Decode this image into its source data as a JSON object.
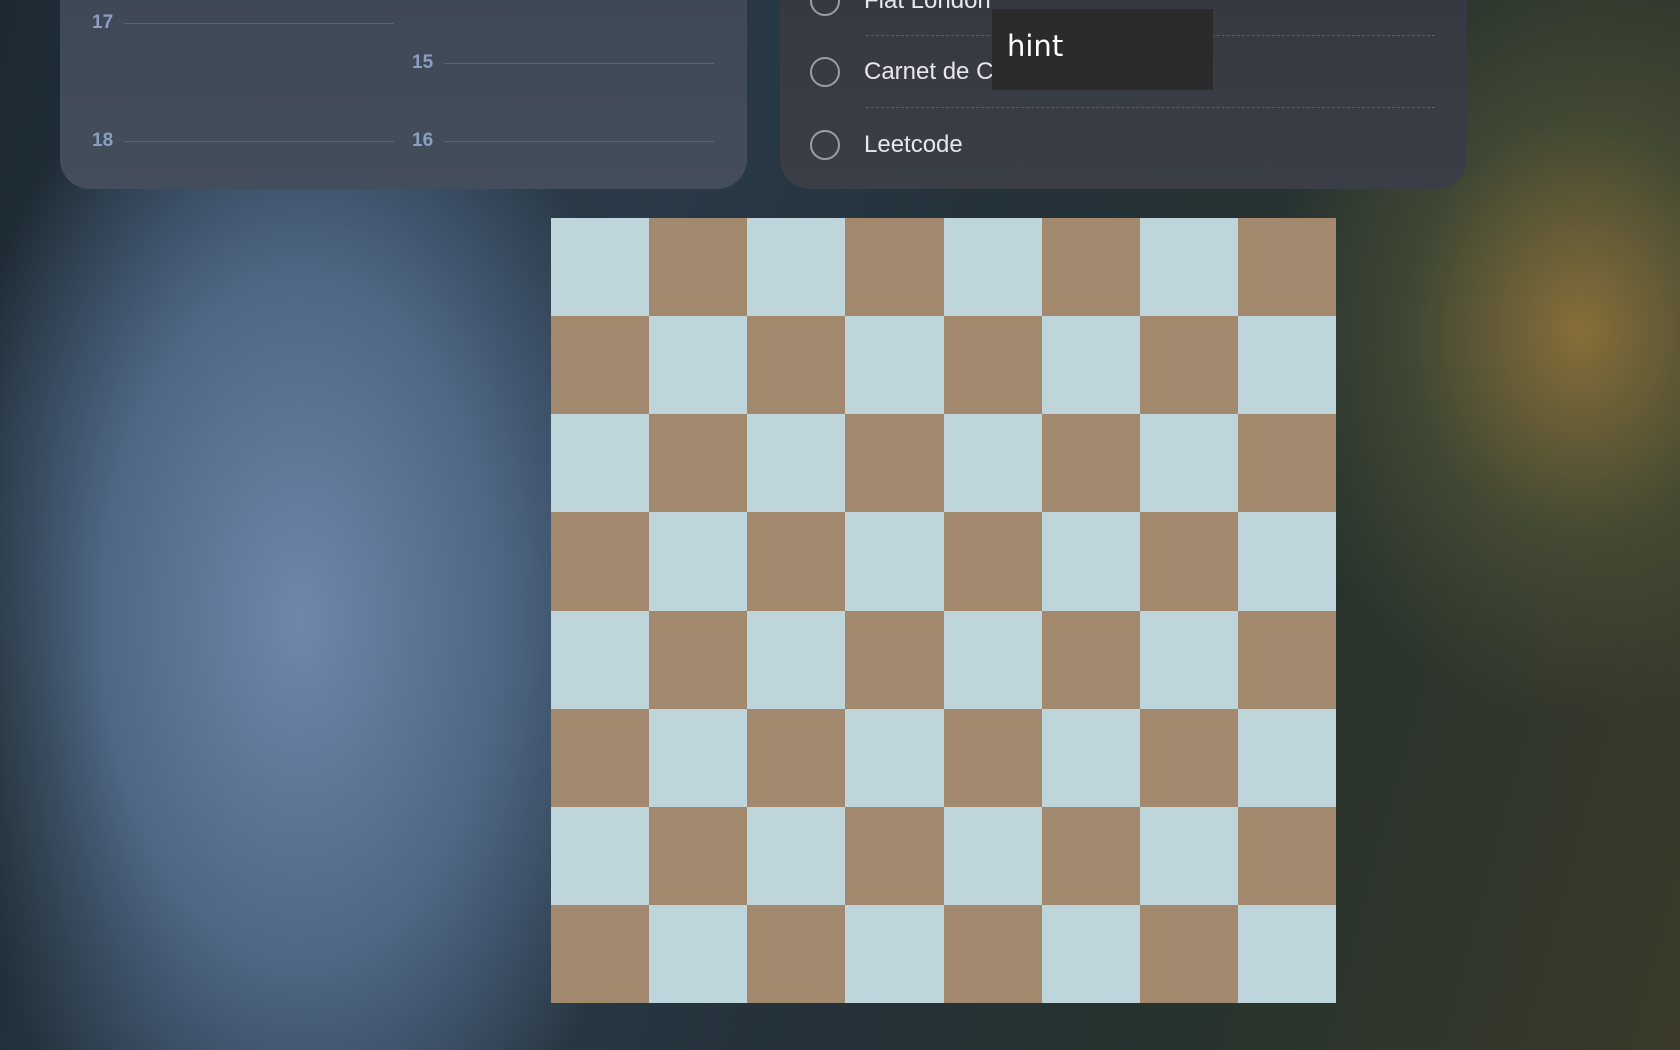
{
  "calendar": {
    "hours": [
      {
        "label": "17"
      },
      {
        "label": "15"
      },
      {
        "label": "18"
      },
      {
        "label": "16"
      }
    ]
  },
  "reminders": {
    "items": [
      {
        "label": "Flat London"
      },
      {
        "label": "Carnet de C"
      },
      {
        "label": "Leetcode"
      }
    ]
  },
  "hint": {
    "text": "hint"
  },
  "chessboard": {
    "rows": 8,
    "cols": 8,
    "light_color": "#bfd5dc",
    "dark_color": "#a2896d"
  }
}
